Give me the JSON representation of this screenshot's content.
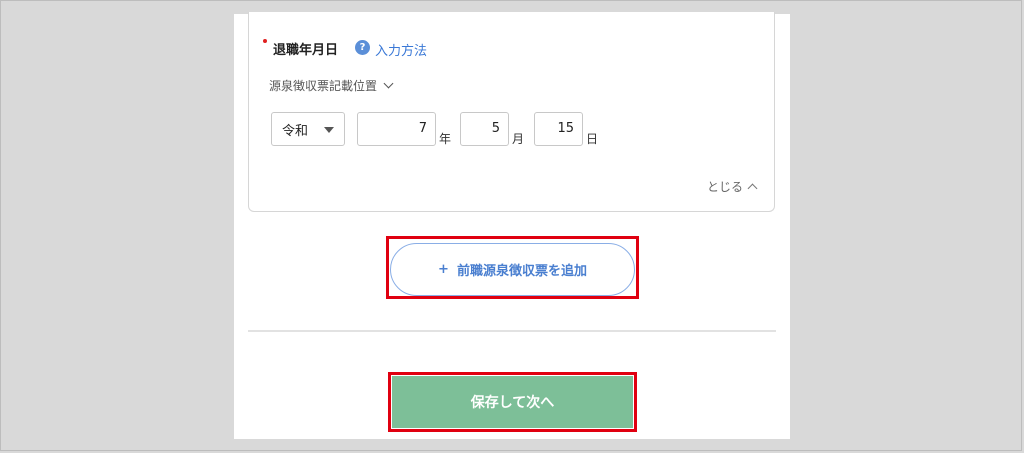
{
  "field": {
    "title": "退職年月日",
    "help_icon": "?",
    "help_link": "入力方法",
    "position_toggle": "源泉徴収票記載位置"
  },
  "date": {
    "era": "令和",
    "year": "7",
    "year_unit": "年",
    "month": "5",
    "month_unit": "月",
    "day": "15",
    "day_unit": "日"
  },
  "close_toggle": "とじる",
  "add_button": {
    "icon": "+",
    "label": "前職源泉徴収票を追加"
  },
  "save_button": {
    "label": "保存して次へ"
  },
  "colors": {
    "accent_blue": "#4a7fd0",
    "save_green": "#7dbf98",
    "highlight_red": "#e00010"
  }
}
